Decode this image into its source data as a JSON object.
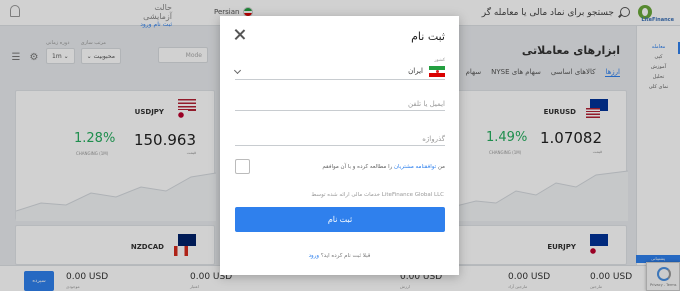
{
  "header": {
    "search_text": "جستجو برای نماد مالی یا معامله گر",
    "language": "Persian",
    "account_title": "حالت آزمایشی",
    "account_signup": "ثبت نام",
    "account_login": "ورود",
    "logo_text": "LiteFinance"
  },
  "sidebar": {
    "items": [
      "معامله",
      "کپی",
      "آموزش",
      "تحلیل",
      "نمای کلی"
    ]
  },
  "main": {
    "title": "ابزارهای معاملاتی",
    "tabs": [
      "ارزها",
      "کالاهای اساسی",
      "سهام های NYSE",
      "سهام"
    ],
    "mode_value": "Mode",
    "sort_label": "مرتب سازی",
    "sort_value": "محبوبیت",
    "period_label": "دوره زمانی",
    "period_value": "1m"
  },
  "cards": [
    {
      "pair": "EURUSD",
      "price": "1.07082",
      "price_label": "قیمت",
      "change": "1.49%",
      "change_label": "CHANGING (1M)"
    },
    {
      "pair": "USDJPY",
      "price": "150.963",
      "price_label": "قیمت",
      "change": "1.28%",
      "change_label": "CHANGING (1M)"
    },
    {
      "pair": "EURJPY"
    },
    {
      "pair": "NZDCAD"
    }
  ],
  "bottom": {
    "deposit": "سپرده",
    "values": [
      "0.00 USD",
      "0.00 USD",
      "0.00 USD",
      "0.00 USD",
      "0.00 USD"
    ],
    "labels": [
      "موجودی",
      "اعتبار",
      "ارزش",
      "مارجین آزاد",
      "مارجین"
    ],
    "help": "پشتیبانی",
    "recaptcha": "Privacy - Terms"
  },
  "modal": {
    "title": "ثبت نام",
    "country_label": "کشور",
    "country_value": "ایران",
    "email_placeholder": "ایمیل یا تلفن",
    "password_placeholder": "گذرواژه",
    "agree_prefix": "من ",
    "agree_link": "توافقنامه مشتریان",
    "agree_suffix": " را مطالعه کرده و با آن موافقم",
    "service_note": "خدمات مالی ارائه شده توسط LiteFinance Global LLC",
    "submit_label": "ثبت نام",
    "login_prefix": "قبلا ثبت نام کرده اید؟ ",
    "login_link": "ورود"
  },
  "colors": {
    "accent": "#2f80ed",
    "positive": "#27ae60"
  }
}
